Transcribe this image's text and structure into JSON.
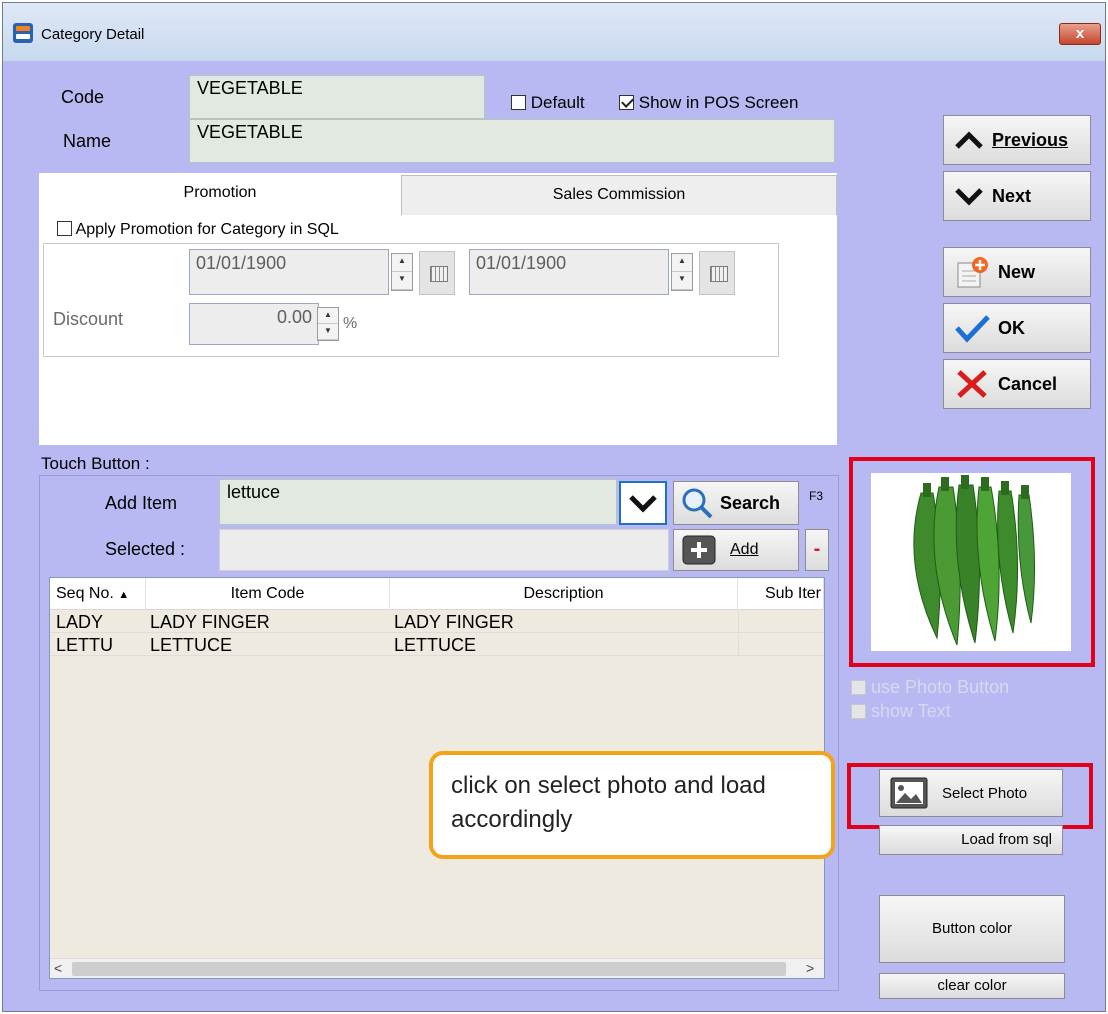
{
  "window": {
    "title": "Category Detail",
    "close_label": "x"
  },
  "form": {
    "code_label": "Code",
    "code_value": "VEGETABLE",
    "name_label": "Name",
    "name_value": "VEGETABLE",
    "default_label": "Default",
    "default_checked": false,
    "show_pos_label": "Show in POS Screen",
    "show_pos_checked": true
  },
  "nav": {
    "previous_label": "Previous",
    "next_label": "Next",
    "new_label": "New",
    "ok_label": "OK",
    "cancel_label": "Cancel"
  },
  "tabs": [
    {
      "label": "Promotion",
      "active": true
    },
    {
      "label": "Sales Commission",
      "active": false
    }
  ],
  "promotion": {
    "apply_label": "Apply Promotion for Category in SQL",
    "apply_checked": false,
    "date_from": "01/01/1900",
    "date_to": "01/01/1900",
    "discount_label": "Discount",
    "discount_value": "0.00",
    "discount_unit": "%"
  },
  "touch": {
    "section_label": "Touch Button :",
    "add_item_label": "Add Item",
    "add_item_value": "lettuce",
    "search_label": "Search",
    "search_shortcut": "F3",
    "selected_label": "Selected :",
    "selected_value": "",
    "add_label": "Add",
    "remove_label": "-"
  },
  "grid": {
    "columns": [
      "Seq No.",
      "Item Code",
      "Description",
      "Sub Iter"
    ],
    "rows": [
      [
        "LADY",
        "LADY FINGER",
        "LADY FINGER",
        ""
      ],
      [
        "LETTU",
        "LETTUCE",
        "LETTUCE",
        ""
      ]
    ]
  },
  "photo": {
    "use_photo_label": "use Photo Button",
    "show_text_label": "show Text",
    "select_photo_label": "Select Photo",
    "load_sql_label": "Load from sql",
    "button_color_label": "Button color",
    "clear_color_label": "clear color"
  },
  "callout": {
    "text": "click on select photo and load accordingly"
  },
  "colors": {
    "form_bg": "#b8b8f2",
    "highlight_red": "#e3001b",
    "callout_border": "#f5a21b"
  }
}
